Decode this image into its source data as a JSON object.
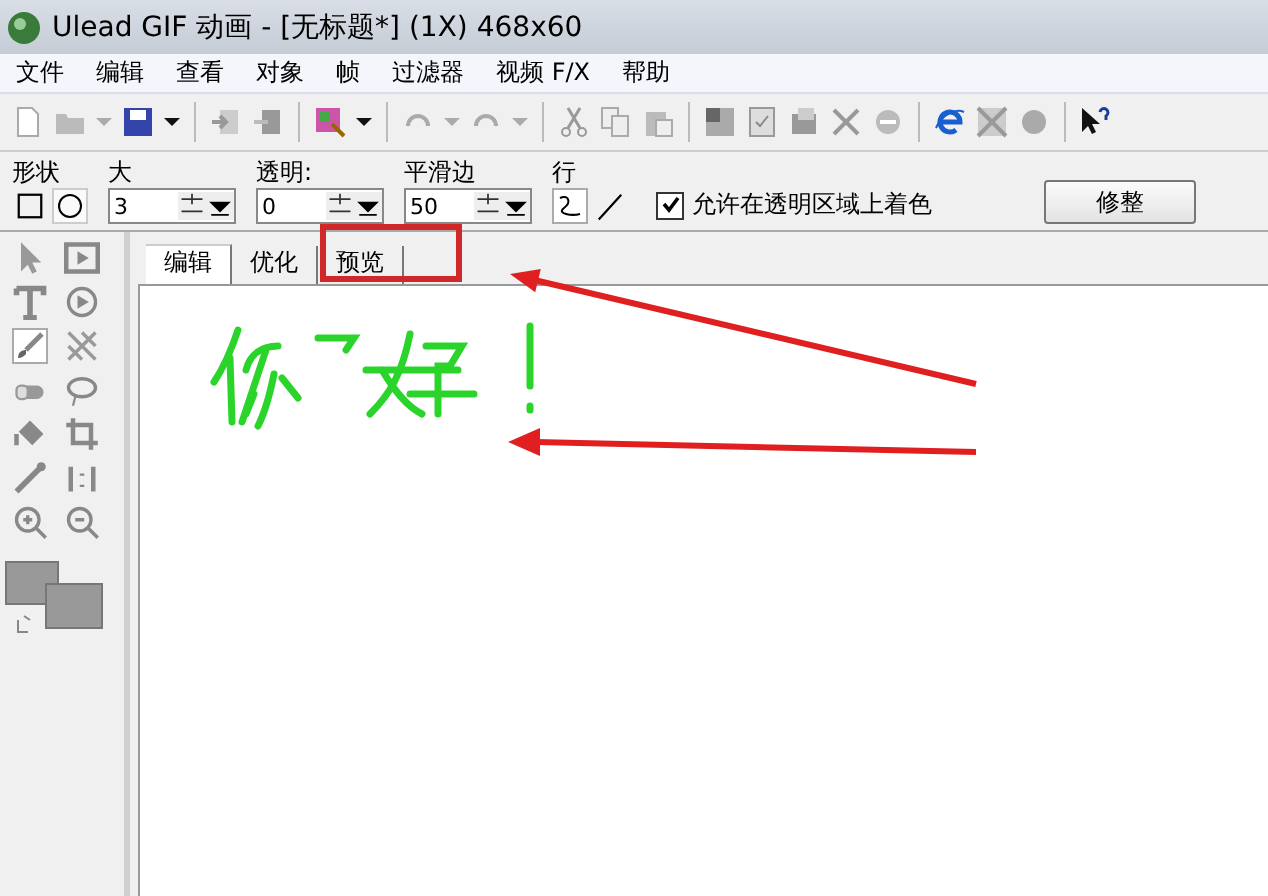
{
  "window": {
    "title": "Ulead GIF 动画 - [无标题*] (1X) 468x60"
  },
  "menu": [
    "文件",
    "编辑",
    "查看",
    "对象",
    "帧",
    "过滤器",
    "视频 F/X",
    "帮助"
  ],
  "options": {
    "shape_label": "形状",
    "size_label": "大",
    "size": "3",
    "transparency_label": "透明:",
    "transparency": "0",
    "smooth_label": "平滑边",
    "smooth": "50",
    "line_label": "行",
    "allow_transparent": {
      "label": "允许在透明区域上着色",
      "checked": true
    },
    "trim_button": "修整"
  },
  "tabs": [
    {
      "label": "编辑",
      "selected": true
    },
    {
      "label": "优化",
      "selected": false
    },
    {
      "label": "预览",
      "selected": false
    }
  ]
}
